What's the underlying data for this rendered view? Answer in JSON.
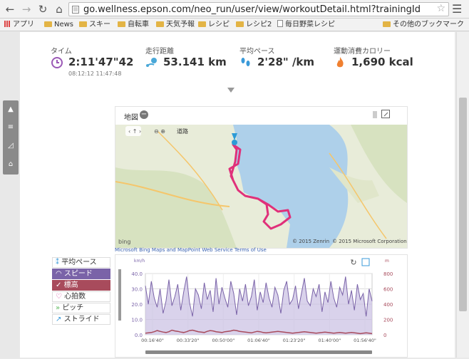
{
  "browser": {
    "url": "go.wellness.epson.com/neo_run/user/view/workoutDetail.html?trainingId",
    "bookmarks": [
      "アプリ",
      "News",
      "スキー",
      "自転車",
      "天気予報",
      "レシピ",
      "レシピ2",
      "毎日野菜レシピ",
      "その他のブックマーク"
    ]
  },
  "stats": {
    "time": {
      "label": "タイム",
      "value": "2:11'47\"42",
      "sub": "08:12:12 11:47:48"
    },
    "distance": {
      "label": "走行距離",
      "value": "53.141 km"
    },
    "pace": {
      "label": "平均ペース",
      "value": "2'28\" /km"
    },
    "calories": {
      "label": "運動消費カロリー",
      "value": "1,690 kcal"
    }
  },
  "map": {
    "title": "地図",
    "controls": {
      "layer": "道路"
    },
    "copyright1": "© 2015 Zenrin",
    "copyright2": "© 2015 Microsoft Corporation",
    "credit": "Microsoft Bing Maps and MapPoint Web Service Terms of Use",
    "bing": "bing"
  },
  "legend": [
    {
      "label": "平均ペース",
      "state": "off"
    },
    {
      "label": "スピード",
      "state": "speed"
    },
    {
      "label": "標高",
      "state": "alt"
    },
    {
      "label": "心拍数",
      "state": "off"
    },
    {
      "label": "ピッチ",
      "state": "off"
    },
    {
      "label": "ストライド",
      "state": "off"
    }
  ],
  "chart_data": {
    "type": "line",
    "x_ticks": [
      "00:16'40\"",
      "00:33'20\"",
      "00:50'00\"",
      "01:06'40\"",
      "01:23'20\"",
      "01:40'00\"",
      "01:56'40\""
    ],
    "left_axis": {
      "unit": "km/h",
      "ticks": [
        "40.0",
        "30.0",
        "20.0",
        "10.0",
        "0.0"
      ],
      "ylim": [
        0,
        40
      ]
    },
    "right_axis": {
      "unit": "m",
      "ticks": [
        "800",
        "600",
        "400",
        "200",
        "0"
      ],
      "ylim": [
        0,
        800
      ]
    },
    "series": [
      {
        "name": "スピード",
        "axis": "left",
        "color": "#7a63a8",
        "values": [
          32,
          20,
          35,
          24,
          18,
          30,
          14,
          22,
          36,
          19,
          25,
          33,
          16,
          28,
          38,
          21,
          12,
          30,
          26,
          17,
          34,
          23,
          29,
          15,
          37,
          20,
          31,
          24,
          18,
          35,
          27,
          13,
          30,
          22,
          33,
          19,
          25,
          36,
          16,
          28,
          21,
          34,
          24,
          18,
          31,
          26,
          14,
          29,
          35,
          20,
          23,
          32,
          17,
          27,
          37,
          22,
          19,
          30,
          25,
          33,
          15,
          28,
          21,
          35,
          24,
          18,
          31,
          26,
          38,
          20,
          29,
          16,
          33,
          23,
          27,
          12,
          30,
          22
        ]
      },
      {
        "name": "標高",
        "axis": "right",
        "color": "#a84b5c",
        "values": [
          20,
          25,
          30,
          40,
          55,
          45,
          35,
          30,
          40,
          60,
          50,
          45,
          35,
          30,
          40,
          55,
          60,
          50,
          40,
          35,
          30,
          45,
          55,
          50,
          40,
          35,
          30,
          40,
          45,
          50,
          60,
          55,
          45,
          40,
          35,
          30,
          25,
          35,
          45,
          40,
          30,
          25,
          30,
          35,
          40,
          45,
          40,
          35,
          30,
          25,
          20,
          25,
          30,
          35,
          40,
          35,
          30,
          25,
          20,
          25,
          30,
          35,
          30,
          25,
          20,
          25,
          30,
          25,
          20,
          25,
          30,
          25,
          20,
          15,
          20,
          25,
          20,
          15
        ]
      }
    ]
  }
}
